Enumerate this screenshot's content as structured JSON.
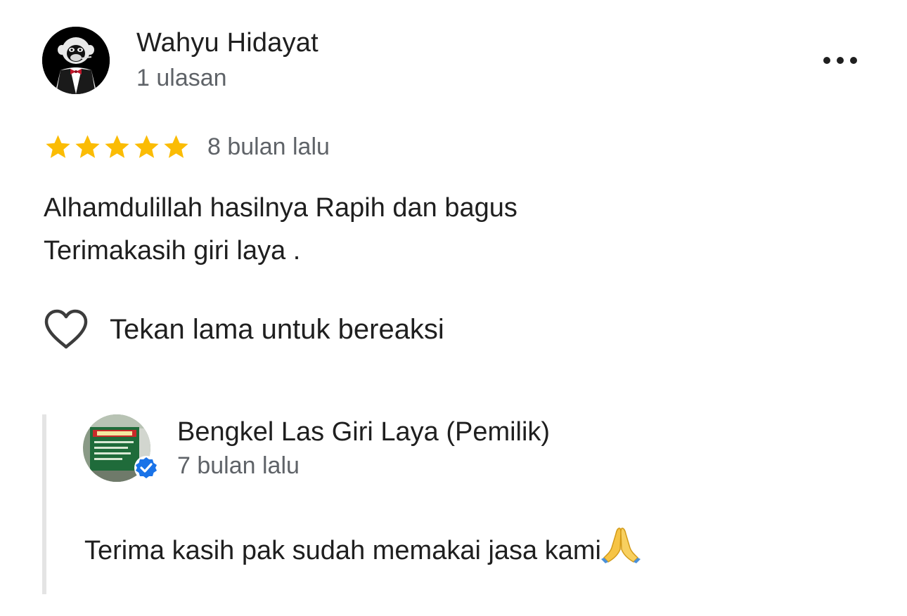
{
  "review": {
    "author": {
      "name": "Wahyu Hidayat",
      "meta": "1 ulasan",
      "avatar_icon": "tuxedo-monkey-avatar"
    },
    "more_icon": "more-horizontal-icon",
    "rating": 5,
    "rating_max": 5,
    "star_color": "#fbbc04",
    "time": "8 bulan lalu",
    "text_lines": [
      "Alhamdulillah hasilnya Rapih dan bagus",
      "Terimakasih giri laya ."
    ],
    "reaction": {
      "icon": "heart-outline-icon",
      "label": "Tekan lama untuk bereaksi"
    }
  },
  "owner_reply": {
    "name": "Bengkel Las Giri Laya (Pemilik)",
    "time": "7 bulan lalu",
    "verified_icon": "verified-badge-icon",
    "verified_color": "#1a73e8",
    "text": "Terima kasih pak sudah memakai jasa kami",
    "emoji_icon": "folded-hands-icon"
  }
}
